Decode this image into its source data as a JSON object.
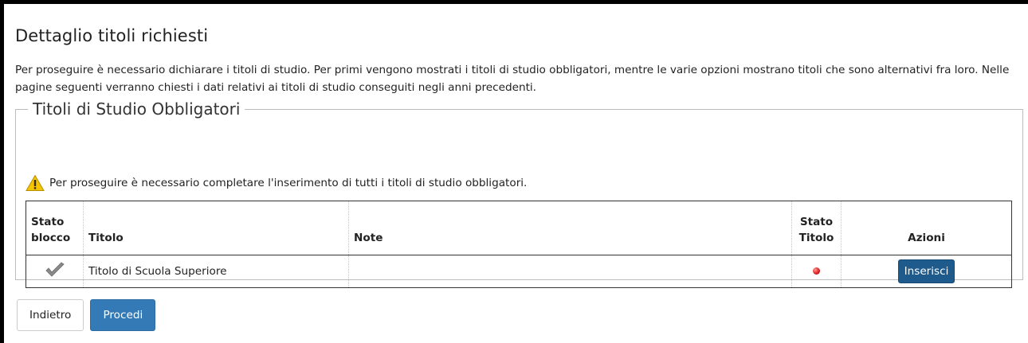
{
  "page": {
    "title": "Dettaglio titoli richiesti",
    "intro": "Per proseguire è necessario dichiarare i titoli di studio. Per primi vengono mostrati i titoli di studio obbligatori, mentre le varie opzioni mostrano titoli che sono alternativi fra loro. Nelle pagine seguenti verranno chiesti i dati relativi ai titoli di studio conseguiti negli anni precedenti."
  },
  "block": {
    "legend": "Titoli di Studio Obbligatori",
    "warning": "Per proseguire è necessario completare l'inserimento di tutti i titoli di studio obbligatori.",
    "warning_icon": "warning-icon"
  },
  "table": {
    "headers": {
      "stato_blocco_line1": "Stato",
      "stato_blocco_line2": "blocco",
      "titolo": "Titolo",
      "note": "Note",
      "stato_titolo_line1": "Stato",
      "stato_titolo_line2": "Titolo",
      "azioni": "Azioni"
    },
    "rows": [
      {
        "stato_blocco_icon": "checkmark-icon",
        "titolo": "Titolo di Scuola Superiore",
        "note": "",
        "stato_titolo_icon": "red-status-dot-icon",
        "action_label": "Inserisci"
      }
    ]
  },
  "buttons": {
    "back": "Indietro",
    "next": "Procedi"
  },
  "colors": {
    "primary": "#337ab7",
    "action": "#1f5a8d",
    "warning": "#f5c400",
    "status_error": "#e02020"
  }
}
